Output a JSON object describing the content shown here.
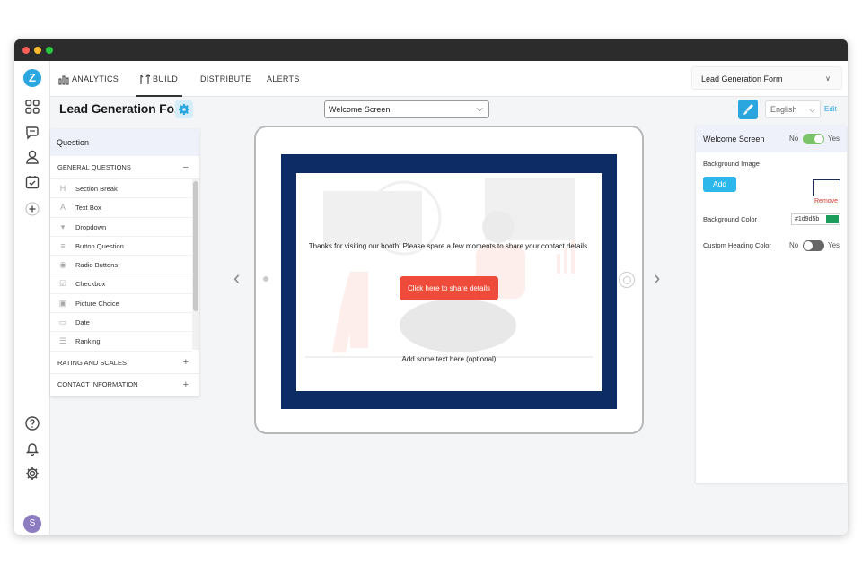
{
  "window": {
    "sidebar": {
      "logo_letter": "Z",
      "icons": [
        "dashboard-grid-icon",
        "chat-icon",
        "user-icon",
        "calendar-check-icon",
        "plus-icon"
      ],
      "bottom_icons": [
        "help-icon",
        "bell-icon",
        "settings-gear-icon"
      ],
      "avatar_letter": "S"
    },
    "nav": {
      "tabs": [
        {
          "label": "ANALYTICS",
          "icon": "bar-chart-icon"
        },
        {
          "label": "BUILD",
          "icon": "tools-icon",
          "active": true
        },
        {
          "label": "DISTRIBUTE"
        },
        {
          "label": "ALERTS"
        }
      ],
      "form_selector": "Lead Generation Form"
    },
    "subbar": {
      "page_title": "Lead Generation Fo...",
      "screen_select": "Welcome Screen",
      "language": "English",
      "edit": "Edit"
    },
    "question_panel": {
      "title": "Question",
      "general_header": "GENERAL QUESTIONS",
      "general_toggle": "−",
      "items": [
        {
          "label": "Section Break",
          "glyph": "H"
        },
        {
          "label": "Text Box",
          "glyph": "A"
        },
        {
          "label": "Dropdown",
          "glyph": "▾"
        },
        {
          "label": "Button Question",
          "glyph": "≡"
        },
        {
          "label": "Radio Buttons",
          "glyph": "◉"
        },
        {
          "label": "Checkbox",
          "glyph": "☑"
        },
        {
          "label": "Picture Choice",
          "glyph": "▣"
        },
        {
          "label": "Date",
          "glyph": "▭"
        },
        {
          "label": "Ranking",
          "glyph": "☰"
        }
      ],
      "rating_header": "RATING AND SCALES",
      "contact_header": "CONTACT INFORMATION",
      "expand_symbol": "+"
    },
    "preview": {
      "welcome_text": "Thanks for visiting our booth! Please spare a few moments to share your contact details.",
      "button_label": "Click here to share details",
      "sub_text": "Add some text here (optional)",
      "bezel_color": "#0d2b65",
      "button_color": "#ef4b3a"
    },
    "settings_panel": {
      "title": "Welcome Screen",
      "welcome_no": "No",
      "welcome_yes": "Yes",
      "welcome_enabled": true,
      "background_image_label": "Background Image",
      "add_label": "Add",
      "remove_label": "Remove",
      "background_color_label": "Background Color",
      "background_color_value": "#1d9d5b",
      "custom_heading_label": "Custom Heading Color",
      "heading_no": "No",
      "heading_yes": "Yes",
      "heading_enabled": false
    }
  }
}
